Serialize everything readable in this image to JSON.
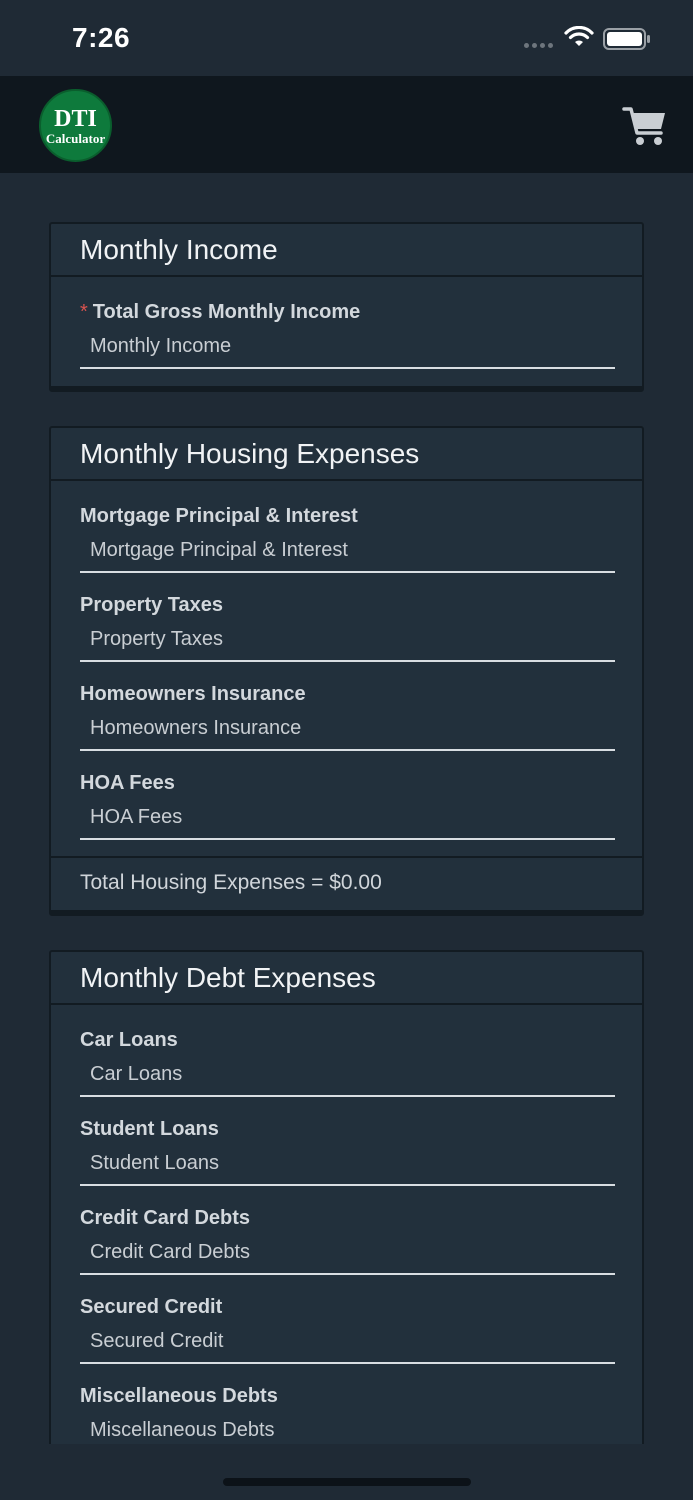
{
  "status_bar": {
    "time": "7:26"
  },
  "header": {
    "logo": {
      "line1": "DTI",
      "line2": "Calculator"
    }
  },
  "income_card": {
    "title": "Monthly Income",
    "required_mark": "*",
    "fields": [
      {
        "label": "Total Gross Monthly Income",
        "placeholder": "Monthly Income",
        "value": ""
      }
    ]
  },
  "housing_card": {
    "title": "Monthly Housing Expenses",
    "fields": [
      {
        "label": "Mortgage Principal & Interest",
        "placeholder": "Mortgage Principal & Interest",
        "value": ""
      },
      {
        "label": "Property Taxes",
        "placeholder": "Property Taxes",
        "value": ""
      },
      {
        "label": "Homeowners Insurance",
        "placeholder": "Homeowners Insurance",
        "value": ""
      },
      {
        "label": "HOA Fees",
        "placeholder": "HOA Fees",
        "value": ""
      }
    ],
    "total": "Total Housing Expenses = $0.00"
  },
  "debt_card": {
    "title": "Monthly Debt Expenses",
    "fields": [
      {
        "label": "Car Loans",
        "placeholder": "Car Loans",
        "value": ""
      },
      {
        "label": "Student Loans",
        "placeholder": "Student Loans",
        "value": ""
      },
      {
        "label": "Credit Card Debts",
        "placeholder": "Credit Card Debts",
        "value": ""
      },
      {
        "label": "Secured Credit",
        "placeholder": "Secured Credit",
        "value": ""
      },
      {
        "label": "Miscellaneous Debts",
        "placeholder": "Miscellaneous Debts",
        "value": ""
      }
    ]
  },
  "colors": {
    "background": "#1f2a35",
    "header": "#0f171e",
    "card": "#22303c",
    "logo_green": "#0e7a3c",
    "required_red": "#d9534f"
  },
  "icons": [
    "signal-dots-icon",
    "wifi-icon",
    "battery-icon",
    "cart-icon"
  ]
}
